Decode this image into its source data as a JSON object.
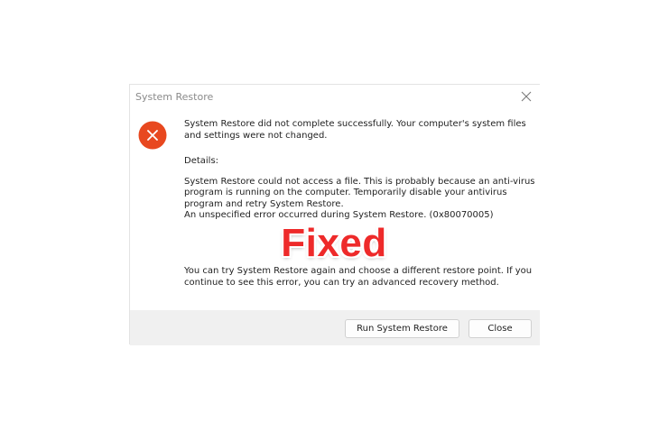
{
  "dialog": {
    "title": "System Restore",
    "message": "System Restore did not complete successfully. Your computer's system files and settings were not changed.",
    "details_label": "Details:",
    "details_text": "System Restore could not access a file. This is probably because an anti-virus program is running on the computer. Temporarily disable your antivirus program and retry System Restore.",
    "error_code_text": "An unspecified error occurred during System Restore. (0x80070005)",
    "advice": "You can try System Restore again and choose a different restore point. If you continue to see this error, you can try an advanced recovery method.",
    "buttons": {
      "run_label": "Run System Restore",
      "close_label": "Close"
    },
    "icons": {
      "error": "error-x-circle-icon",
      "close": "close-icon"
    }
  },
  "overlay": {
    "text": "Fixed"
  },
  "colors": {
    "error_icon": "#e8481f",
    "overlay_text": "#ee2a2a",
    "footer_bg": "#f0f0f0"
  }
}
